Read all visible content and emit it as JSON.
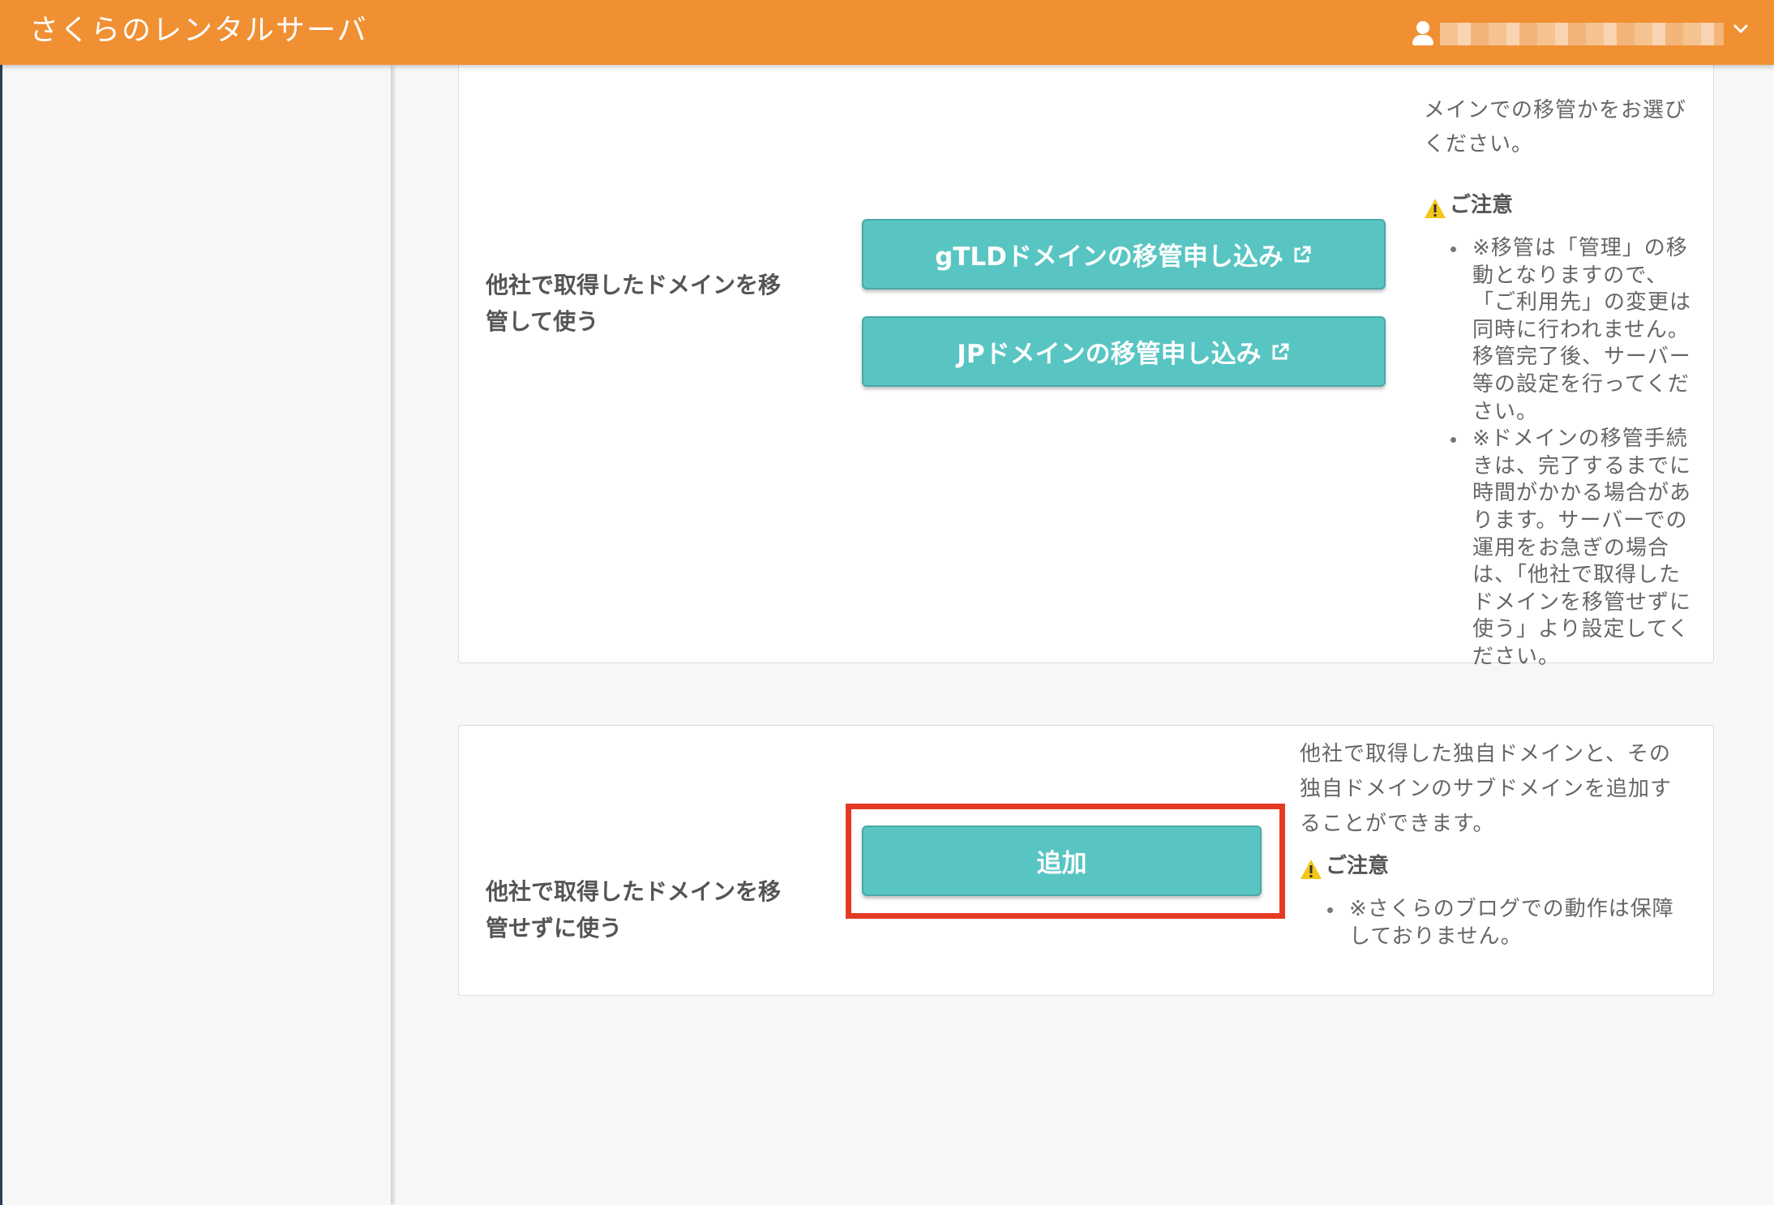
{
  "header": {
    "brand": "さくらのレンタルサーバ",
    "user_caret": "⌄"
  },
  "card_transfer": {
    "label_line1": "他社で取得したドメインを移",
    "label_line2": "管して使う",
    "gtld_button": "gTLDドメインの移管申し込み",
    "jp_button": "JPドメインの移管申し込み",
    "desc_line1": "メインでの移管かをお選び",
    "desc_line2": "ください。",
    "notice_title": "ご注意",
    "notes": [
      [
        "※移管は「管理」の移",
        "動となりますので、",
        "「ご利用先」の変更は",
        "同時に行われません。",
        "移管完了後、サーバー",
        "等の設定を行ってくだ",
        "さい。"
      ],
      [
        "※ドメインの移管手続",
        "きは、完了するまでに",
        "時間がかかる場合があ",
        "ります。サーバーでの",
        "運用をお急ぎの場合",
        "は、「他社で取得した",
        "ドメインを移管せずに",
        "使う」より設定してく",
        "ださい。"
      ]
    ]
  },
  "card_add": {
    "label_line1": "他社で取得したドメインを移",
    "label_line2": "管せずに使う",
    "add_button": "追加",
    "desc_line1": "他社で取得した独自ドメインと、その",
    "desc_line2": "独自ドメインのサブドメインを追加す",
    "desc_line3": "ることができます。",
    "notice_title": "ご注意",
    "notes": [
      [
        "※さくらのブログでの動作は保障",
        "しておりません。"
      ]
    ]
  },
  "colors": {
    "header_bg": "#f09033",
    "button_bg": "#58c5c3",
    "highlight_border": "#e53b25",
    "warning_icon": "#f5c518"
  },
  "icons": [
    "user-icon",
    "chevron-down-icon",
    "external-link-icon",
    "warning-icon"
  ]
}
